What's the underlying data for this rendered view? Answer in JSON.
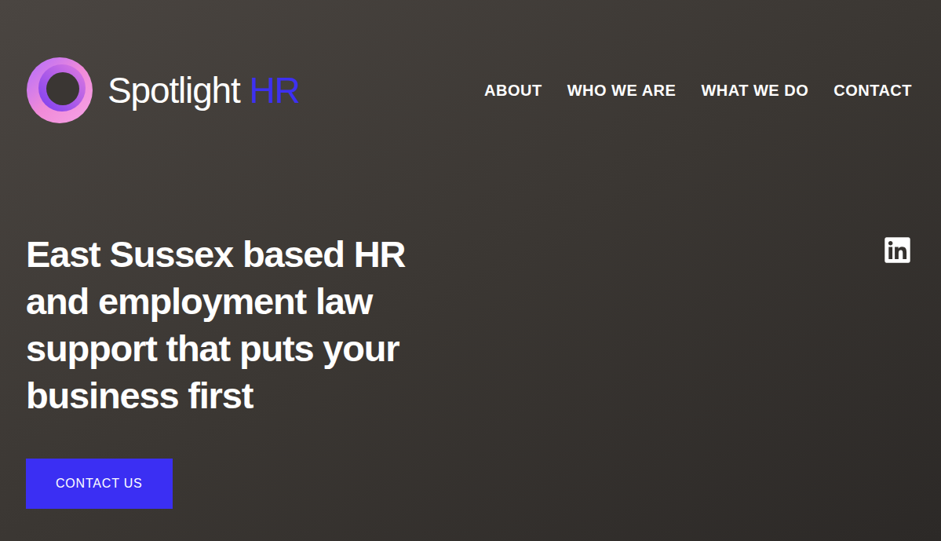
{
  "logo": {
    "name": "Spotlight",
    "accent": "HR"
  },
  "nav": [
    "ABOUT",
    "WHO WE ARE",
    "WHAT WE DO",
    "CONTACT"
  ],
  "hero": {
    "headline": "East Sussex based HR and employment law support that puts your business first",
    "button": "CONTACT US"
  }
}
